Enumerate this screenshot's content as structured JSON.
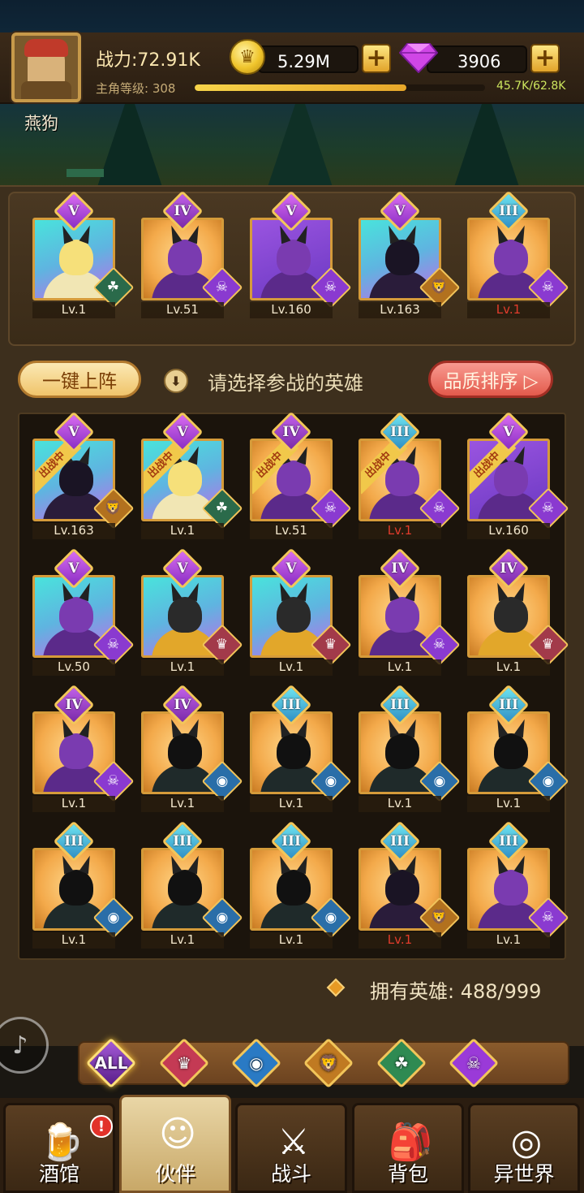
{
  "header": {
    "player_name": "燕狗",
    "power": "战力:72.91K",
    "level_label": "主角等级: 308",
    "xp_text": "45.7K/62.8K",
    "xp_progress": 0.73,
    "gold": "5.29M",
    "gems": "3906",
    "gold_icon": "crown-coin-icon",
    "gem_icon": "purple-diamond-icon"
  },
  "team": [
    {
      "rank": "V",
      "faction": "elf",
      "level": "Lv.1",
      "level_red": false,
      "bg": "teal"
    },
    {
      "rank": "IV",
      "faction": "demon",
      "level": "Lv.51",
      "level_red": false,
      "bg": "gold"
    },
    {
      "rank": "V",
      "faction": "demon",
      "level": "Lv.160",
      "level_red": false,
      "bg": "purple"
    },
    {
      "rank": "V",
      "faction": "beast",
      "level": "Lv.163",
      "level_red": false,
      "bg": "teal"
    },
    {
      "rank": "III",
      "faction": "demon",
      "level": "Lv.1",
      "level_red": true,
      "bg": "gold"
    }
  ],
  "actions": {
    "one_click_label": "一键上阵",
    "hint": "请选择参战的英雄",
    "sort_label": "品质排序 ▷"
  },
  "battle_tag": "出战中",
  "heroes": [
    {
      "rank": "V",
      "faction": "beast",
      "level": "Lv.163",
      "level_red": false,
      "bg": "teal",
      "deployed": true
    },
    {
      "rank": "V",
      "faction": "elf",
      "level": "Lv.1",
      "level_red": false,
      "bg": "teal",
      "deployed": true
    },
    {
      "rank": "IV",
      "faction": "demon",
      "level": "Lv.51",
      "level_red": false,
      "bg": "gold",
      "deployed": true
    },
    {
      "rank": "III",
      "faction": "demon",
      "level": "Lv.1",
      "level_red": true,
      "bg": "gold",
      "deployed": true
    },
    {
      "rank": "V",
      "faction": "demon",
      "level": "Lv.160",
      "level_red": false,
      "bg": "purple",
      "deployed": true
    },
    {
      "rank": "V",
      "faction": "demon",
      "level": "Lv.50",
      "level_red": false,
      "bg": "teal",
      "deployed": false
    },
    {
      "rank": "V",
      "faction": "order",
      "level": "Lv.1",
      "level_red": false,
      "bg": "teal",
      "deployed": false
    },
    {
      "rank": "V",
      "faction": "order",
      "level": "Lv.1",
      "level_red": false,
      "bg": "teal",
      "deployed": false
    },
    {
      "rank": "IV",
      "faction": "demon",
      "level": "Lv.1",
      "level_red": false,
      "bg": "gold",
      "deployed": false
    },
    {
      "rank": "IV",
      "faction": "order",
      "level": "Lv.1",
      "level_red": false,
      "bg": "gold",
      "deployed": false
    },
    {
      "rank": "IV",
      "faction": "demon",
      "level": "Lv.1",
      "level_red": false,
      "bg": "gold",
      "deployed": false
    },
    {
      "rank": "IV",
      "faction": "ocean",
      "level": "Lv.1",
      "level_red": false,
      "bg": "gold",
      "deployed": false
    },
    {
      "rank": "III",
      "faction": "ocean",
      "level": "Lv.1",
      "level_red": false,
      "bg": "gold",
      "deployed": false
    },
    {
      "rank": "III",
      "faction": "ocean",
      "level": "Lv.1",
      "level_red": false,
      "bg": "gold",
      "deployed": false
    },
    {
      "rank": "III",
      "faction": "ocean",
      "level": "Lv.1",
      "level_red": false,
      "bg": "gold",
      "deployed": false
    },
    {
      "rank": "III",
      "faction": "ocean",
      "level": "Lv.1",
      "level_red": false,
      "bg": "gold",
      "deployed": false
    },
    {
      "rank": "III",
      "faction": "ocean",
      "level": "Lv.1",
      "level_red": false,
      "bg": "gold",
      "deployed": false
    },
    {
      "rank": "III",
      "faction": "ocean",
      "level": "Lv.1",
      "level_red": false,
      "bg": "gold",
      "deployed": false
    },
    {
      "rank": "III",
      "faction": "beast",
      "level": "Lv.1",
      "level_red": true,
      "bg": "gold",
      "deployed": false
    },
    {
      "rank": "III",
      "faction": "demon",
      "level": "Lv.1",
      "level_red": false,
      "bg": "gold",
      "deployed": false
    }
  ],
  "owned": "拥有英雄: 488/999",
  "filters": [
    {
      "key": "all",
      "label": "ALL",
      "icon": "all-factions-icon"
    },
    {
      "key": "order",
      "label": "♛",
      "icon": "order-faction-icon"
    },
    {
      "key": "ocean",
      "label": "◉",
      "icon": "ocean-faction-icon"
    },
    {
      "key": "beast",
      "label": "🦁",
      "icon": "beast-faction-icon"
    },
    {
      "key": "elf",
      "label": "☘",
      "icon": "elf-faction-icon"
    },
    {
      "key": "demon",
      "label": "☠",
      "icon": "demon-faction-icon"
    }
  ],
  "nav": [
    {
      "key": "tavern",
      "label": "酒馆",
      "icon": "beer-mug-icon",
      "glyph": "🍺",
      "alert": "!",
      "active": false
    },
    {
      "key": "partners",
      "label": "伙伴",
      "icon": "partner-portrait-icon",
      "glyph": "☺",
      "alert": "",
      "active": true
    },
    {
      "key": "battle",
      "label": "战斗",
      "icon": "crossed-swords-icon",
      "glyph": "⚔",
      "alert": "",
      "active": false
    },
    {
      "key": "bag",
      "label": "背包",
      "icon": "backpack-icon",
      "glyph": "🎒",
      "alert": "",
      "active": false
    },
    {
      "key": "otherworld",
      "label": "异世界",
      "icon": "portal-icon",
      "glyph": "◎",
      "alert": "",
      "active": false
    }
  ],
  "colors": {
    "panel_brown": "#3d2f1d",
    "gold_border": "#d59b3a",
    "level_red": "#e13c2c",
    "xp_fill": "#f7d44a",
    "xp_text": "#cde65e"
  }
}
